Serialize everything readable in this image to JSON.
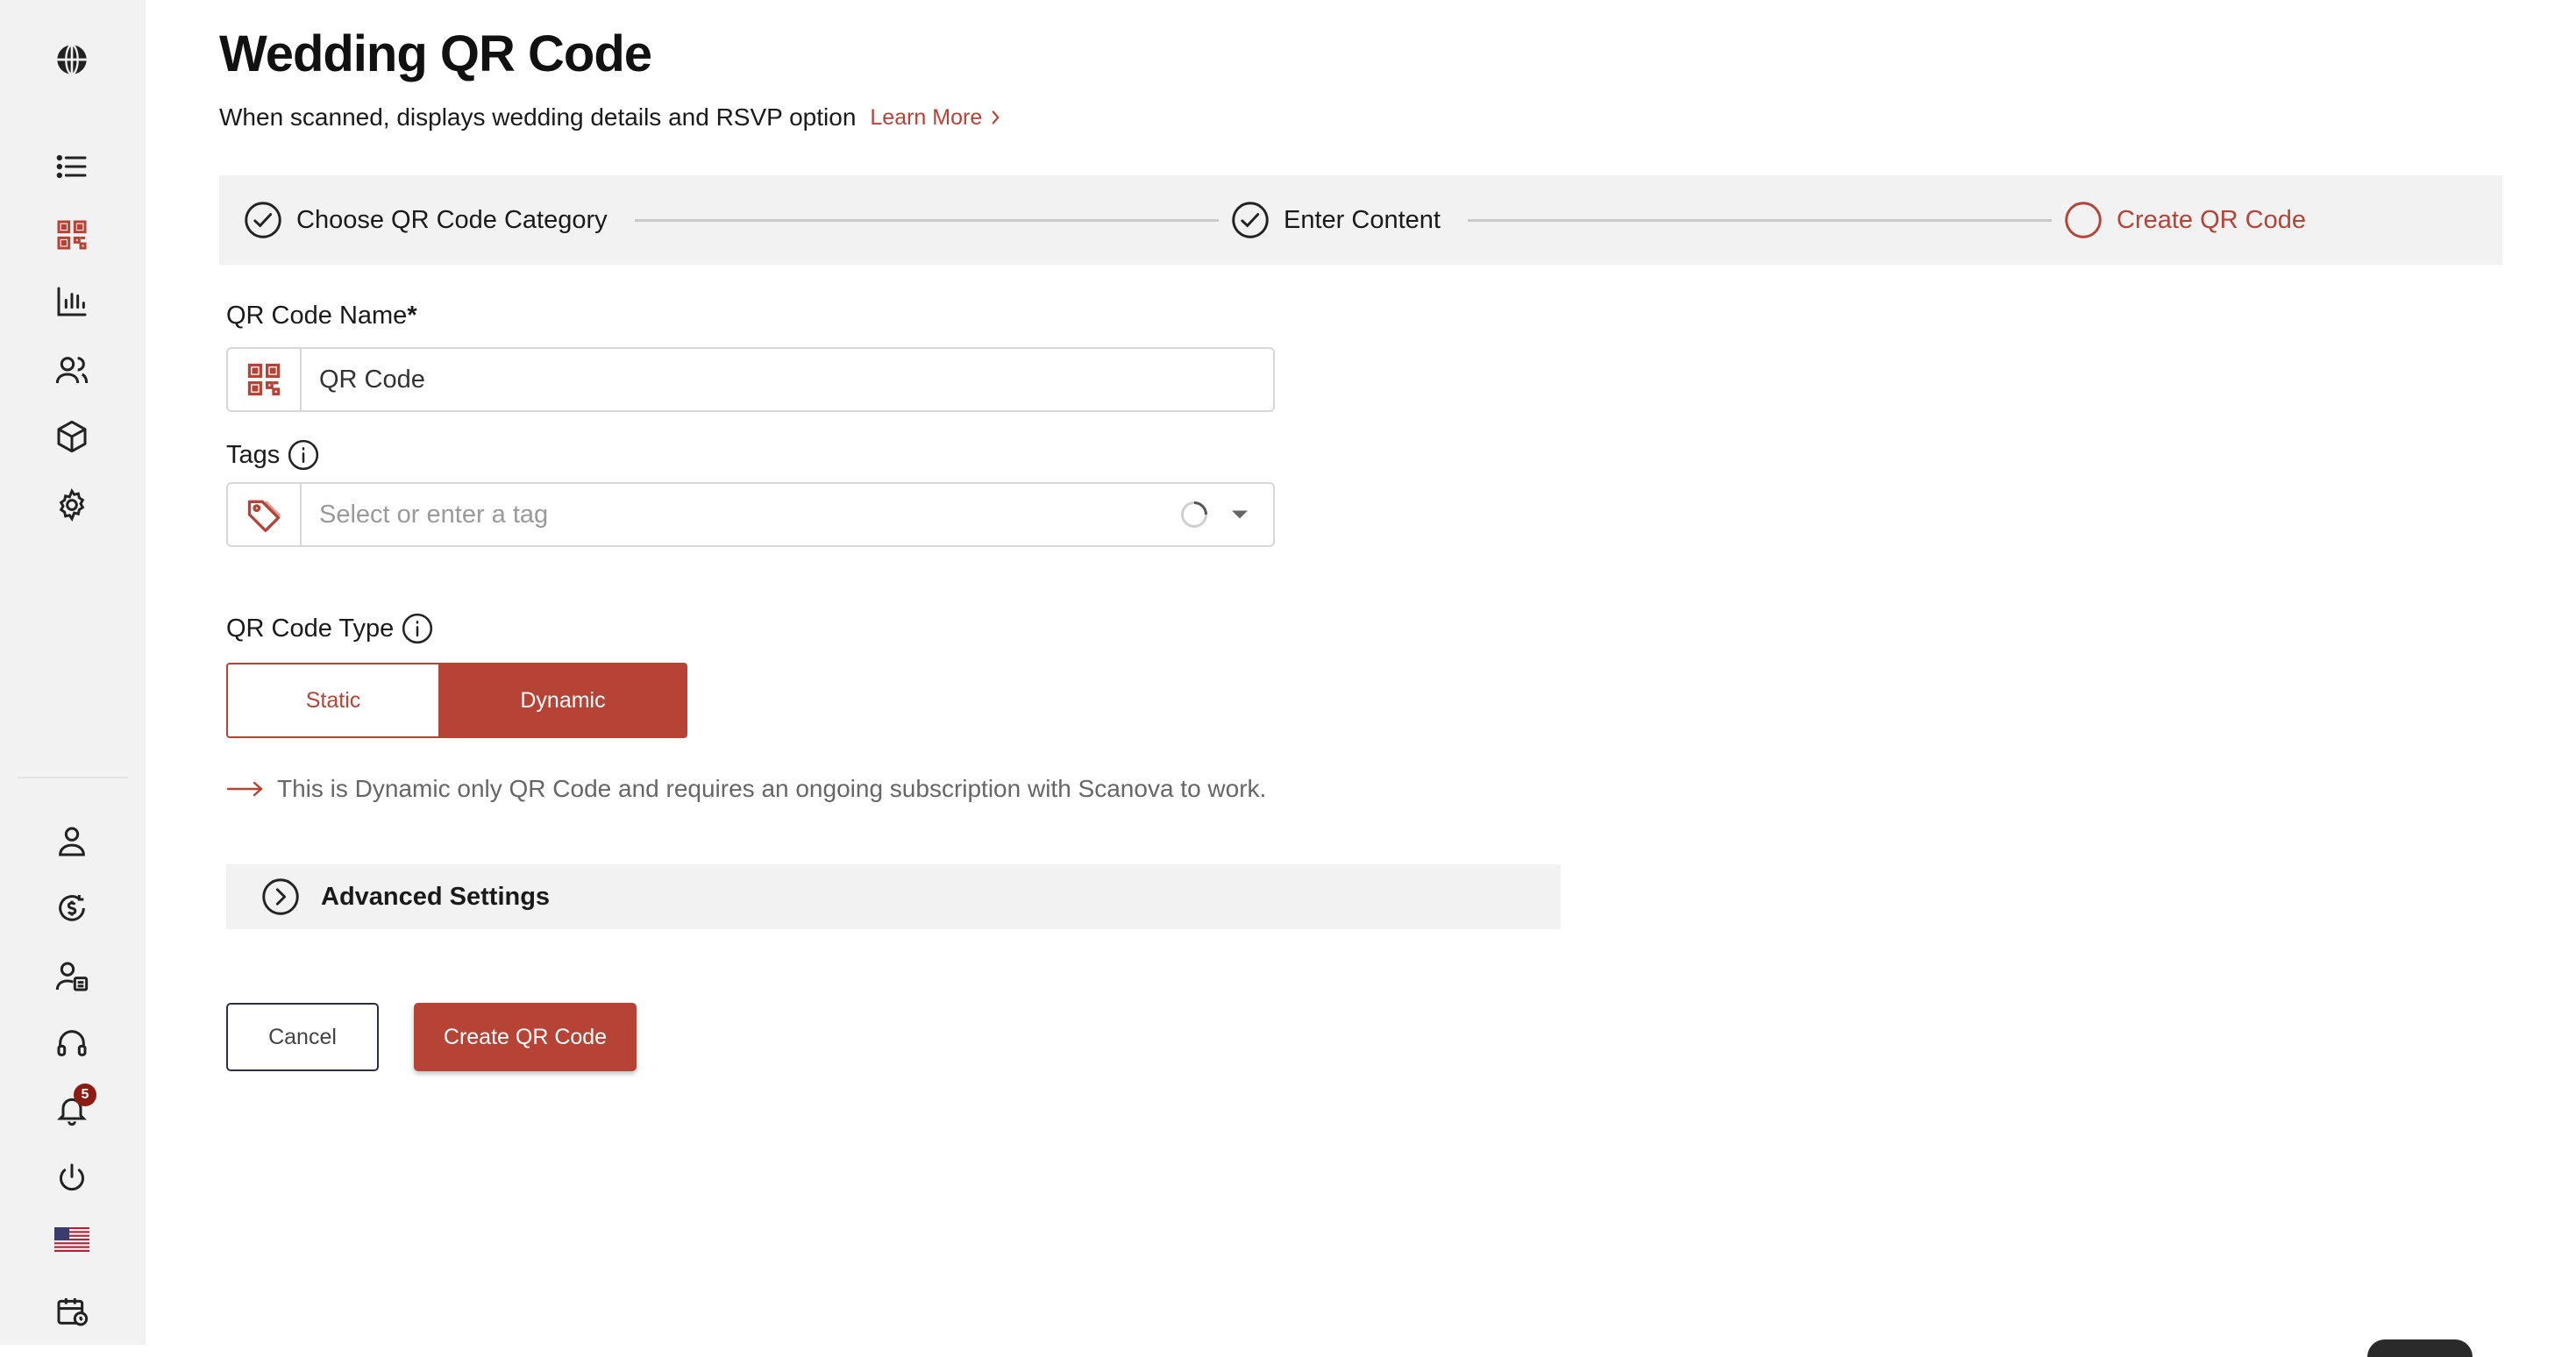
{
  "colors": {
    "accent": "#b54336",
    "sidebar_bg": "#f2f2f2",
    "stepper_bg": "#f2f2f2"
  },
  "sidebar": {
    "top_icons": [
      "globe-icon",
      "list-icon",
      "qr-code-icon",
      "bar-chart-icon",
      "users-icon",
      "cube-icon",
      "gear-icon"
    ],
    "bottom_icons": [
      "user-icon",
      "billing-icon",
      "user-badge-icon",
      "headset-icon",
      "bell-icon",
      "power-icon",
      "us-flag-icon",
      "calendar-icon"
    ],
    "notification_count": "5"
  },
  "page": {
    "title": "Wedding QR Code",
    "subtitle": "When scanned, displays wedding details and RSVP option",
    "learn_more": "Learn More"
  },
  "stepper": {
    "steps": [
      {
        "label": "Choose QR Code Category",
        "state": "done"
      },
      {
        "label": "Enter Content",
        "state": "done"
      },
      {
        "label": "Create QR Code",
        "state": "current"
      }
    ]
  },
  "form": {
    "name_label": "QR Code Name",
    "name_required": "*",
    "name_value": "QR Code",
    "tags_label": "Tags",
    "tags_placeholder": "Select or enter a tag",
    "type_label": "QR Code Type",
    "type_options": [
      "Static",
      "Dynamic"
    ],
    "type_selected": "Dynamic",
    "dynamic_note": "This is Dynamic only QR Code and requires an ongoing subscription with Scanova to work.",
    "advanced_label": "Advanced Settings"
  },
  "actions": {
    "cancel": "Cancel",
    "create": "Create QR Code"
  }
}
